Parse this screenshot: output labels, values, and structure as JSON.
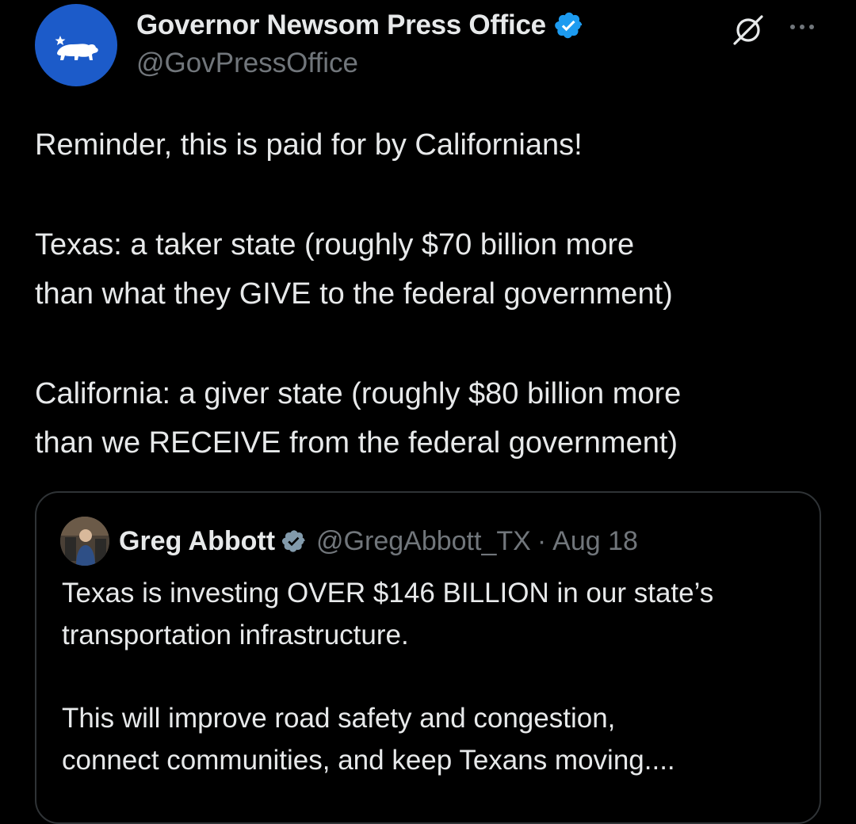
{
  "post": {
    "author": {
      "display_name": "Governor Newsom Press Office",
      "handle": "@GovPressOffice",
      "verified": true,
      "avatar_icon": "california-bear-icon",
      "avatar_color": "#1c5bc9"
    },
    "text_lines": [
      "Reminder, this is paid for by Californians!",
      "Texas: a taker state (roughly $70 billion more",
      "than what they GIVE to the federal government)",
      "California: a giver state (roughly $80 billion more",
      "than we RECEIVE from the federal government)"
    ],
    "actions": {
      "grok_icon": "grok-icon",
      "more_icon": "more-options-icon"
    }
  },
  "quote": {
    "author": {
      "display_name": "Greg Abbott",
      "handle": "@GregAbbott_TX",
      "separator": "·",
      "date": "Aug 18",
      "verified_badge": "gray-verified-icon"
    },
    "text_lines": [
      "Texas is investing OVER $146 BILLION in our state’s",
      "transportation infrastructure.",
      "This will improve road safety and congestion,",
      "connect communities, and keep Texans moving...."
    ]
  },
  "colors": {
    "background": "#000000",
    "primary_text": "#e7e9ea",
    "secondary_text": "#71767b",
    "verified_blue": "#1d9bf0",
    "border": "#2f3336"
  }
}
